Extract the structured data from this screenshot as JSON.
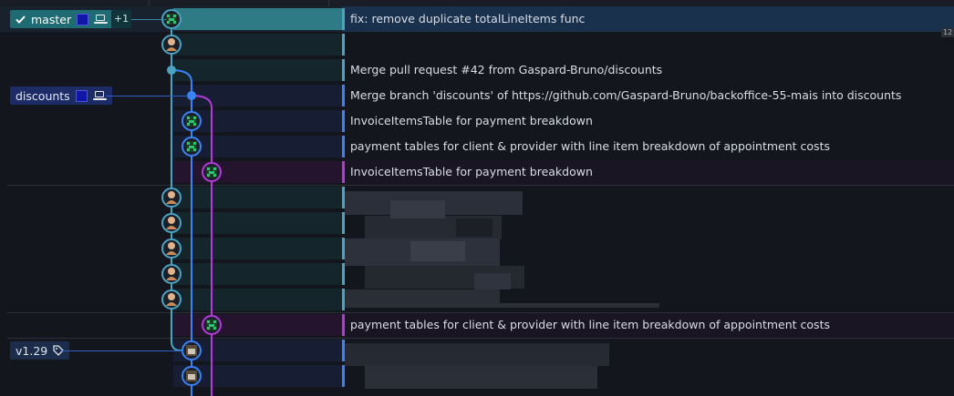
{
  "refs": {
    "master": {
      "label": "master",
      "extra_count": "+1"
    },
    "discounts": {
      "label": "discounts"
    },
    "tag": {
      "label": "v1.29"
    }
  },
  "commits": [
    {
      "message": "fix: remove duplicate totalLineItems func",
      "lane": "teal",
      "avatar": "green"
    },
    {
      "message": "",
      "lane": "teal",
      "avatar": "person"
    },
    {
      "message": "Merge pull request #42 from Gaspard-Bruno/discounts",
      "lane": "teal",
      "avatar": "merge-dot"
    },
    {
      "message": "Merge branch 'discounts' of https://github.com/Gaspard-Bruno/backoffice-55-mais into discounts",
      "lane": "blue",
      "avatar": "merge-dot"
    },
    {
      "message": "InvoiceItemsTable for payment breakdown",
      "lane": "blue",
      "avatar": "green"
    },
    {
      "message": "payment tables for client & provider with line item breakdown of appointment costs",
      "lane": "blue",
      "avatar": "green"
    },
    {
      "message": "InvoiceItemsTable for payment breakdown",
      "lane": "purple",
      "avatar": "green"
    },
    {
      "message": "",
      "lane": "teal",
      "avatar": "person"
    },
    {
      "message": "",
      "lane": "teal",
      "avatar": "person"
    },
    {
      "message": "",
      "lane": "teal",
      "avatar": "person"
    },
    {
      "message": "",
      "lane": "teal",
      "avatar": "person"
    },
    {
      "message": "",
      "lane": "teal",
      "avatar": "person"
    },
    {
      "message": "payment tables for client & provider with line item breakdown of appointment costs",
      "lane": "purple",
      "avatar": "green"
    },
    {
      "message": "",
      "lane": "blue",
      "avatar": "robot"
    },
    {
      "message": "",
      "lane": "blue",
      "avatar": "robot"
    }
  ],
  "scroll_badge": "12",
  "colors": {
    "teal": "#4aa3c3",
    "blue": "#3b82f6",
    "purple": "#b13ad9",
    "green": "#2ec46a"
  },
  "icons": [
    "check-icon",
    "laptop-icon",
    "tag-icon",
    "avatar-icon"
  ]
}
